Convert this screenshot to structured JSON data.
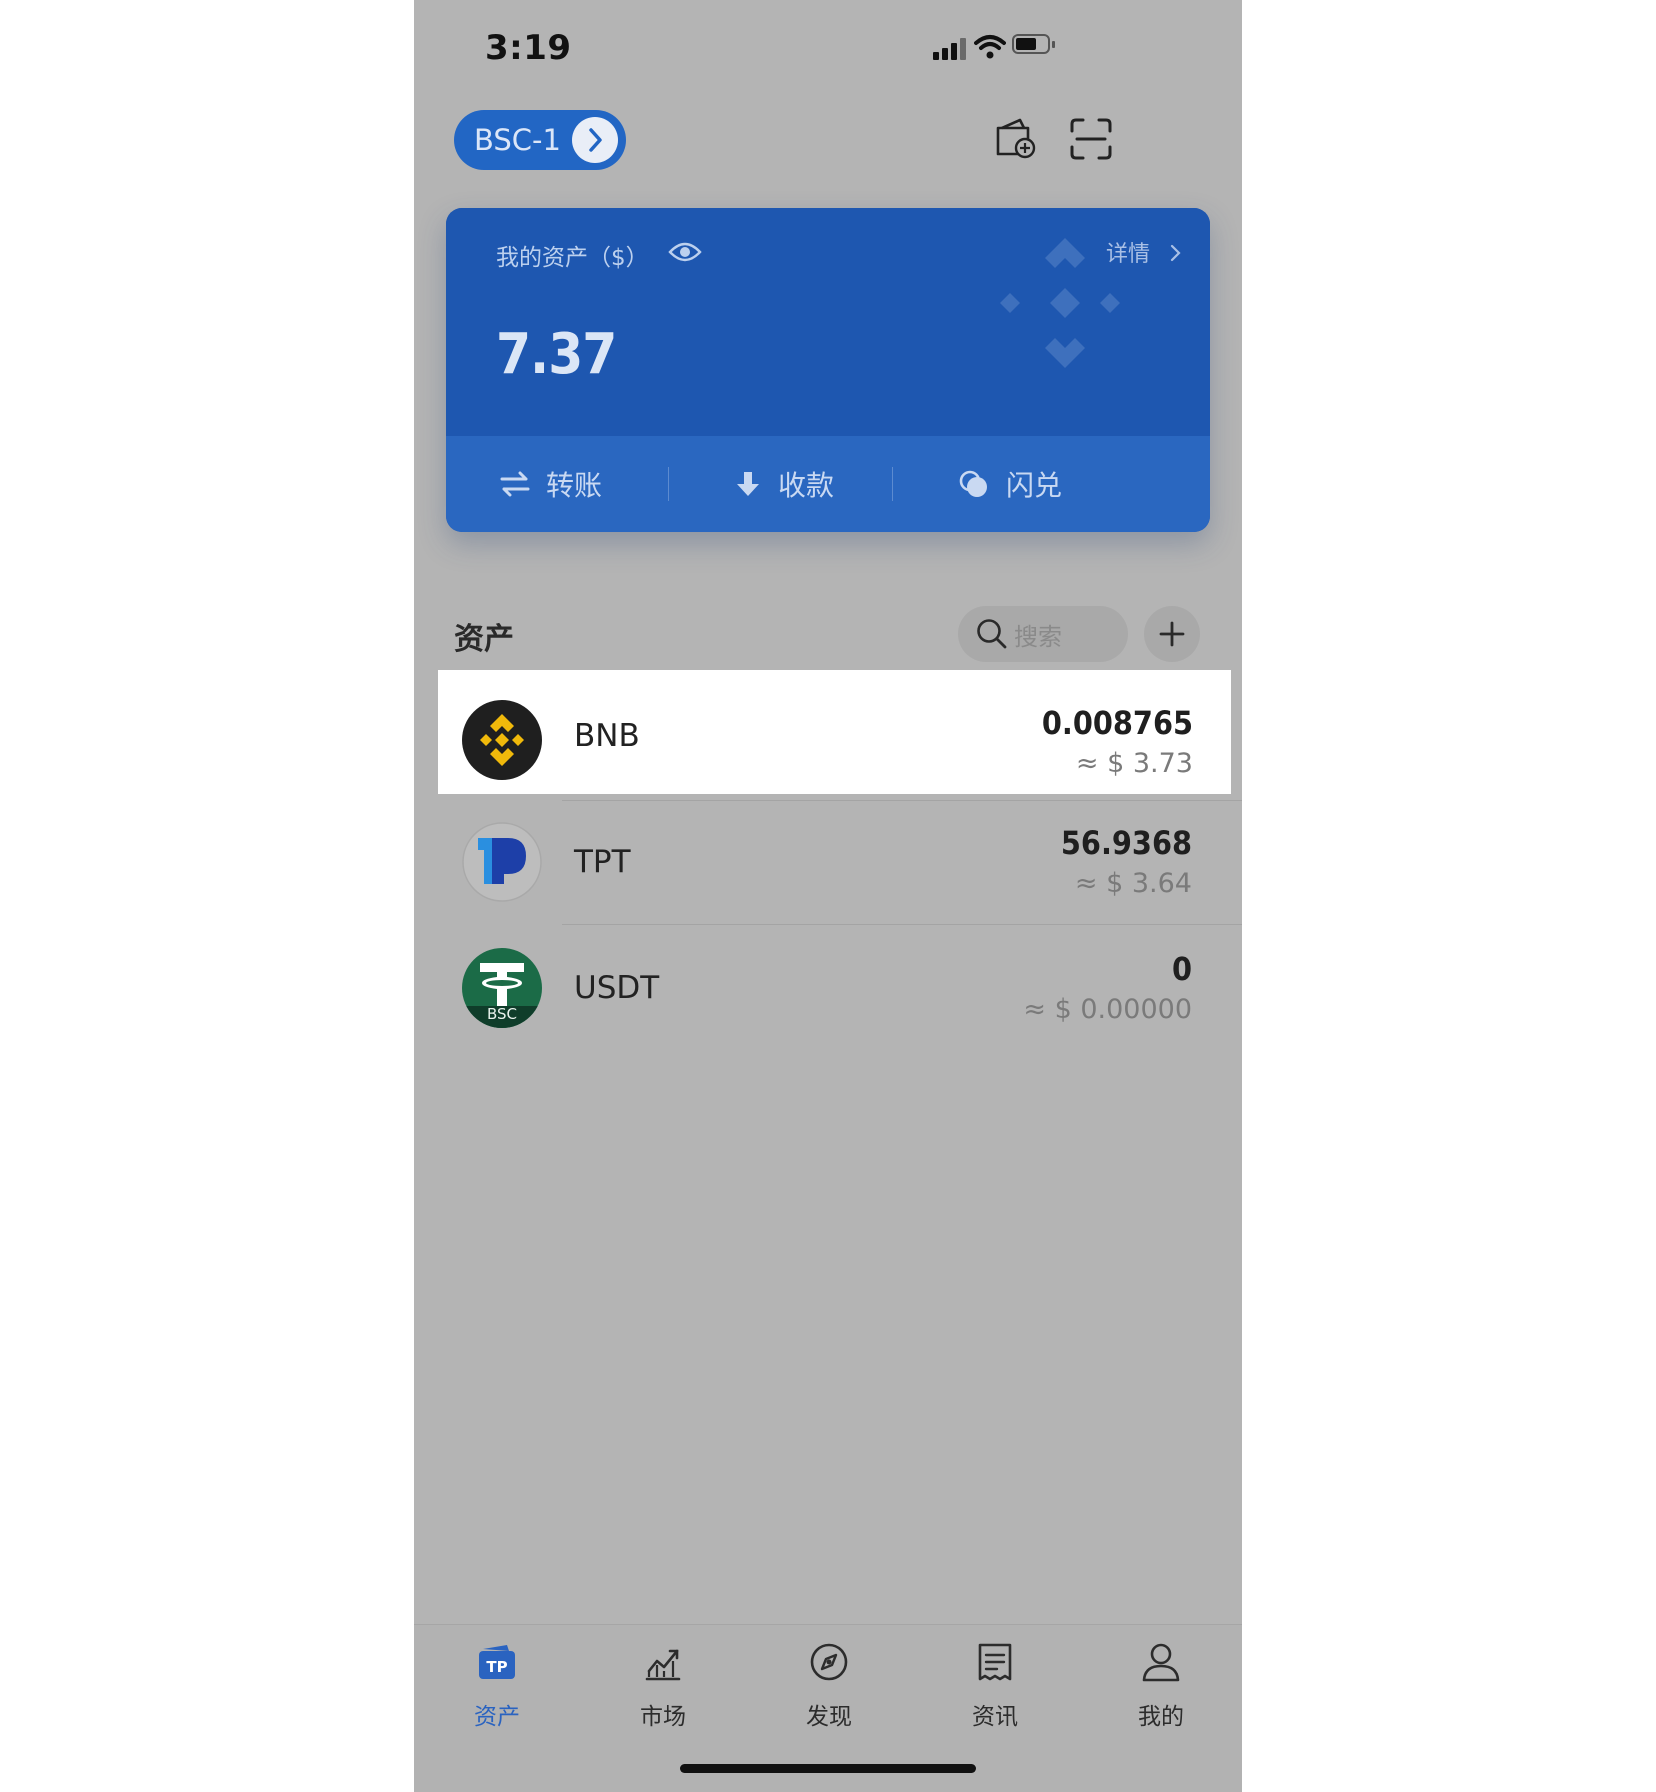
{
  "status_bar": {
    "time": "3:19"
  },
  "header": {
    "wallet_name": "BSC-1"
  },
  "card": {
    "label": "我的资产（$）",
    "value": "7.37",
    "detail_label": "详情",
    "actions": {
      "transfer": "转账",
      "receive": "收款",
      "swap": "闪兑"
    }
  },
  "assets": {
    "title": "资产",
    "search_placeholder": "搜索",
    "tokens": [
      {
        "name": "BNB",
        "amount": "0.008765",
        "fiat": "≈ $ 3.73"
      },
      {
        "name": "TPT",
        "amount": "56.9368",
        "fiat": "≈ $ 3.64"
      },
      {
        "name": "USDT",
        "amount": "0",
        "fiat": "≈ $ 0.00000",
        "badge": "BSC"
      }
    ]
  },
  "tabbar": {
    "tabs": [
      {
        "label": "资产",
        "icon": "tp-wallet-icon",
        "active": true
      },
      {
        "label": "市场",
        "icon": "market-chart-icon"
      },
      {
        "label": "发现",
        "icon": "compass-icon"
      },
      {
        "label": "资讯",
        "icon": "news-icon"
      },
      {
        "label": "我的",
        "icon": "profile-icon"
      }
    ],
    "active_color": "#2a63c0"
  }
}
